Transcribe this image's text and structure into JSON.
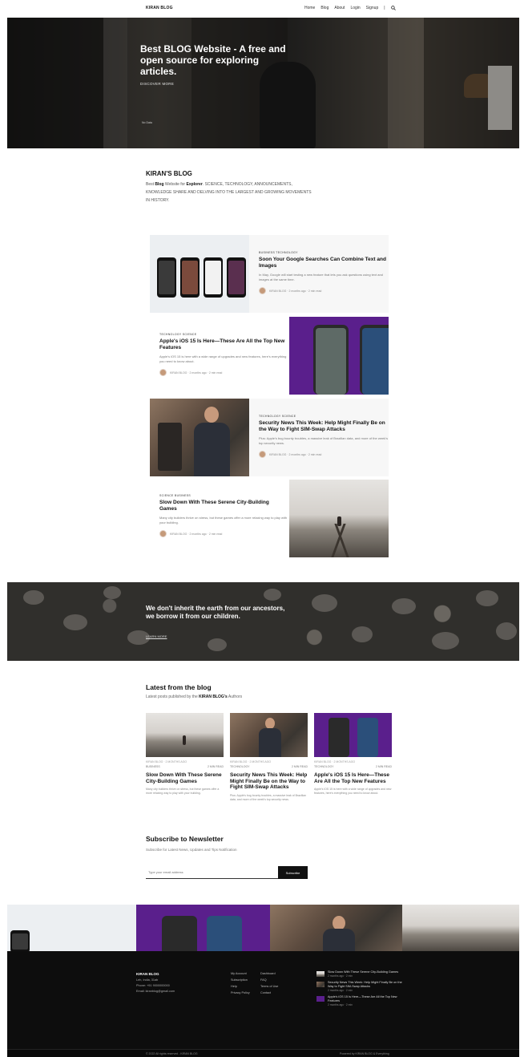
{
  "nav": {
    "brand": "KIRAN BLOG",
    "links": [
      "Home",
      "Blog",
      "About",
      "Login",
      "Signup"
    ]
  },
  "hero": {
    "title": "Best BLOG Website - A free and open source for exploring articles.",
    "subtitle": "DISCOVER MORE",
    "badge": "No Data"
  },
  "intro": {
    "title": "KIRAN'S BLOG",
    "text_prefix": "Best ",
    "text_bold1": "Blog",
    "text_mid": " Website for ",
    "text_bold2": "Explorer",
    "text_rest": ". SCIENCE, TECHNOLOGY, ANNOUNCEMENTS, KNOWLEDGE SHARE AND DELVING INTO THE LARGEST AND GROWING MOVEMENTS IN HISTORY."
  },
  "articles": [
    {
      "category": "BUSINESS   TECHNOLOGY",
      "title": "Soon Your Google Searches Can Combine Text and Images",
      "excerpt": "In May, Google will start testing a new feature that lets you ask questions using text and images at the same time.",
      "meta": "KIRAN BLOG · 2 months ago · 2 min read"
    },
    {
      "category": "TECHNOLOGY   SCIENCE",
      "title": "Apple's iOS 15 Is Here—These Are All the Top New Features",
      "excerpt": "Apple's iOS 15 is here with a wide range of upgrades and new features, here's everything you need to know about.",
      "meta": "KIRAN BLOG · 2 months ago · 2 min read"
    },
    {
      "category": "TECHNOLOGY   SCIENCE",
      "title": "Security News This Week: Help Might Finally Be on the Way to Fight SIM-Swap Attacks",
      "excerpt": "Plus: Apple's bug bounty troubles, a massive leak of Brazilian data, and more of the week's top security news.",
      "meta": "KIRAN BLOG · 2 months ago · 2 min read"
    },
    {
      "category": "SCIENCE   BUSINESS",
      "title": "Slow Down With These Serene City-Building Games",
      "excerpt": "Many city builders thrive on stress, but these games offer a more relaxing way to play with your building.",
      "meta": "KIRAN BLOG · 2 months ago · 2 min read"
    }
  ],
  "quote": {
    "text": "We don't inherit the earth from our ancestors, we borrow it from our children.",
    "link": "LEARN MORE"
  },
  "latest": {
    "title": "Latest from the blog",
    "sub_prefix": "Latest posts published by the ",
    "sub_bold": "KIRAN BLOG's",
    "sub_suffix": " Authors",
    "posts": [
      {
        "date": "KIRAN BLOG · 2 MONTHS AGO",
        "tag": "BUSINESS",
        "read": "2 MIN READ",
        "title": "Slow Down With These Serene City-Building Games",
        "excerpt": "Many city builders thrive on stress, but these games offer a more relaxing way to play with your building."
      },
      {
        "date": "KIRAN BLOG · 2 MONTHS AGO",
        "tag": "TECHNOLOGY",
        "read": "2 MIN READ",
        "title": "Security News This Week: Help Might Finally Be on the Way to Fight SIM-Swap Attacks",
        "excerpt": "Plus: Apple's bug bounty troubles, a massive leak of Brazilian data, and more of the week's top security news."
      },
      {
        "date": "KIRAN BLOG · 2 MONTHS AGO",
        "tag": "TECHNOLOGY",
        "read": "2 MIN READ",
        "title": "Apple's iOS 15 Is Here—These Are All the Top New Features",
        "excerpt": "Apple's iOS 15 is here with a wide range of upgrades and new features, here's everything you need to know about."
      }
    ]
  },
  "subscribe": {
    "title": "Subscribe to Newsletter",
    "text": "Subscribe for Latest News, Updates and Tips Notification",
    "placeholder": "Type your email address",
    "button": "Subscribe"
  },
  "footer": {
    "brand": "KIRAN BLOG",
    "lines": [
      "Leh, India, 31ab",
      "Phone: +91 9000000000",
      "Email: kiranblog@gmail.com"
    ],
    "col1": [
      "My Account",
      "Subscription",
      "Help",
      "Privacy Policy"
    ],
    "col2": [
      "Dashboard",
      "FAQ",
      "Terms of Use",
      "Contact"
    ],
    "recent": [
      {
        "title": "Slow Down With These Serene City-Building Games",
        "date": "2 months ago · 2 min"
      },
      {
        "title": "Security News This Week: Help Might Finally Be on the Way to Fight SIM-Swap Attacks",
        "date": "2 months ago · 2 min"
      },
      {
        "title": "Apple's iOS 15 Is Here—These Are All the Top New Features",
        "date": "2 months ago · 2 min"
      }
    ],
    "copyright": "© 2022 All rights reserved - KIRAN BLOG",
    "powered": "Powered by KIRAN BLOG & Everything"
  },
  "colors": {
    "purple": "#5a1f8c",
    "footer_bg": "#0d0d0d",
    "card_bg": "#f7f7f7"
  },
  "icons": {
    "search": "search-icon"
  }
}
